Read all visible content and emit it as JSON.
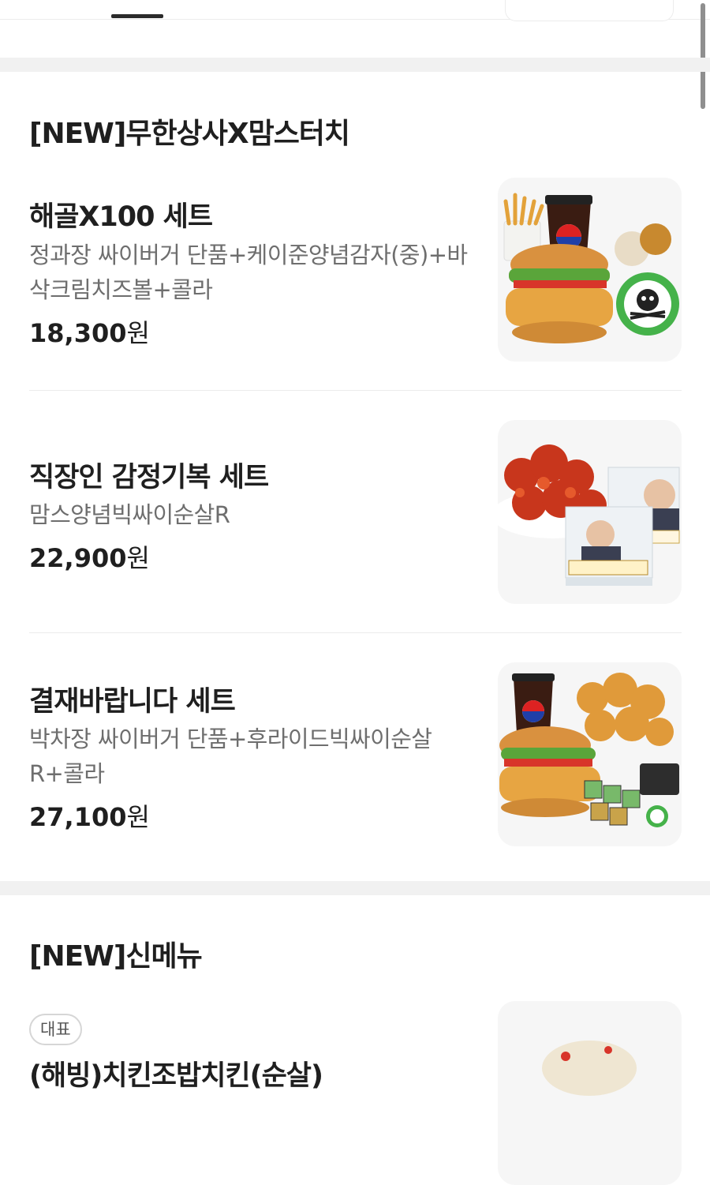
{
  "sections": [
    {
      "title": "[NEW]무한상사X맘스터치",
      "items": [
        {
          "name": "해골X100 세트",
          "desc": "정과장 싸이버거 단품+케이준양념감자(중)+바삭크림치즈볼+콜라",
          "price": "18,300",
          "currency": "원",
          "image": "burger-set-skull-image"
        },
        {
          "name": "직장인 감정기복 세트",
          "desc": "맘스양념빅싸이순살R",
          "price": "22,900",
          "currency": "원",
          "image": "chicken-nameplate-image"
        },
        {
          "name": "결재바랍니다 세트",
          "desc": "박차장 싸이버거 단품+후라이드빅싸이순살R+콜라",
          "price": "27,100",
          "currency": "원",
          "image": "burger-chicken-set-image"
        }
      ]
    },
    {
      "title": "[NEW]신메뉴",
      "items": [
        {
          "badge": "대표",
          "name": "(해빙)치킨조밥치킨(순살)",
          "image": "new-menu-image"
        }
      ]
    }
  ],
  "colors": {
    "text": "#1f1f1f",
    "subtext": "#6e6e6e",
    "divider": "#f1f1f1",
    "thumb_bg": "#f6f6f6"
  }
}
